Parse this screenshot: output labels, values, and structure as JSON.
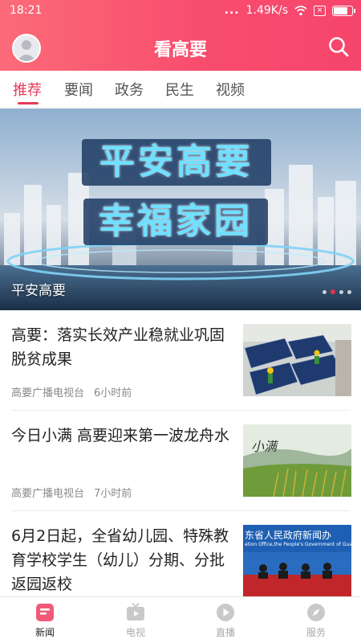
{
  "status": {
    "time": "18:21",
    "signal": "...",
    "speed": "1.49K/s"
  },
  "header": {
    "title": "看高要"
  },
  "tabs": [
    {
      "label": "推荐",
      "active": true
    },
    {
      "label": "要闻"
    },
    {
      "label": "政务"
    },
    {
      "label": "民生"
    },
    {
      "label": "视频"
    }
  ],
  "banner": {
    "headline_line1": "平安高要",
    "headline_line2": "幸福家园",
    "caption": "平安高要",
    "slide_count": 3,
    "active_slide": 1
  },
  "news": [
    {
      "title": "高要：落实长效产业稳就业巩固脱贫成果",
      "source": "高要广播电视台",
      "time": "6小时前",
      "thumb": "solar-panels"
    },
    {
      "title": "今日小满 高要迎来第一波龙舟水",
      "source": "高要广播电视台",
      "time": "7小时前",
      "thumb": "rice-field",
      "thumb_text": "小满"
    },
    {
      "title": "6月2日起，全省幼儿园、特殊教育学校学生（幼儿）分期、分批返园返校",
      "source": "",
      "time": "",
      "thumb": "press-conference",
      "thumb_text1": "东省人民政府新闻办",
      "thumb_text2": "ation Office,the People's Government of Guangdon"
    }
  ],
  "bottom_nav": [
    {
      "label": "新闻",
      "icon": "news-icon",
      "active": true
    },
    {
      "label": "电视",
      "icon": "tv-icon"
    },
    {
      "label": "直播",
      "icon": "live-play-icon"
    },
    {
      "label": "服务",
      "icon": "service-compass-icon"
    }
  ],
  "colors": {
    "accent": "#e83a5a",
    "header_from": "#fb6b78",
    "header_to": "#f6456c"
  }
}
